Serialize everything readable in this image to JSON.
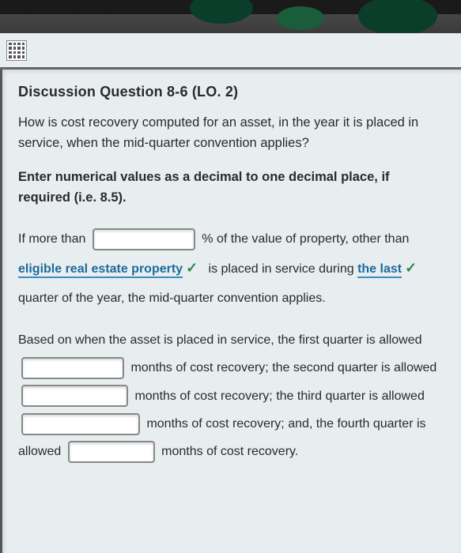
{
  "title": "Discussion Question 8-6 (LO. 2)",
  "question": "How is cost recovery computed for an asset, in the year it is placed in service, when the mid-quarter convention applies?",
  "instruction": "Enter numerical values as a decimal to one decimal place, if required (i.e. 8.5).",
  "paragraph1": {
    "t1": "If more than",
    "t2": "% of the value of property, other than",
    "select1": "eligible real estate property",
    "t3": "is placed in service during",
    "select2": "the last",
    "t4": "quarter of the year, the mid-quarter convention applies."
  },
  "paragraph2": {
    "t1": "Based on when the asset is placed in service, the first quarter is allowed",
    "t2": "months of cost recovery; the second quarter is allowed",
    "t3": "months of cost recovery; the third quarter is allowed",
    "t4": "months of cost recovery; and, the fourth quarter is allowed",
    "t5": "months of cost recovery."
  },
  "check": "✓"
}
